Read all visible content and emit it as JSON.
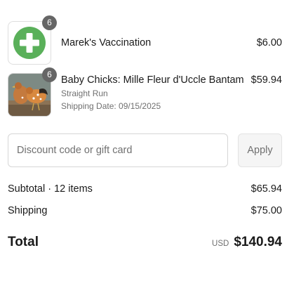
{
  "items": [
    {
      "quantity": "6",
      "title": "Marek's Vaccination",
      "price": "$6.00",
      "icon": "green-plus-icon"
    },
    {
      "quantity": "6",
      "title": "Baby Chicks: Mille Fleur d'Uccle Bantam",
      "variant": "Straight Run",
      "shipping_date": "Shipping Date: 09/15/2025",
      "price": "$59.94",
      "image": "chicken-photo"
    }
  ],
  "discount": {
    "placeholder": "Discount code or gift card",
    "value": "",
    "apply_label": "Apply"
  },
  "summary": {
    "subtotal_label": "Subtotal · 12 items",
    "subtotal_value": "$65.94",
    "shipping_label": "Shipping",
    "shipping_value": "$75.00",
    "total_label": "Total",
    "currency": "USD",
    "total_value": "$140.94"
  },
  "colors": {
    "plus_icon_green": "#5ab05a",
    "badge": "#666666",
    "text_muted": "#707070"
  }
}
